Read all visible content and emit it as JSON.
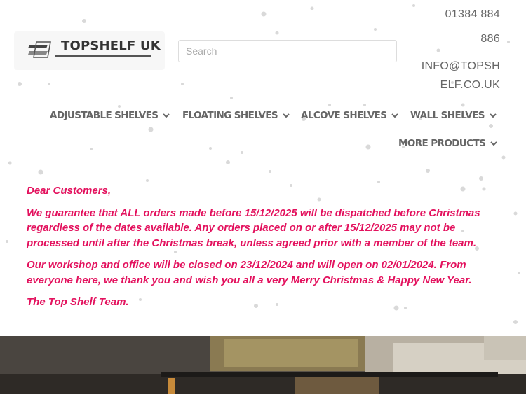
{
  "header": {
    "logo_text": "TOPSHELF UK",
    "search": {
      "placeholder": "Search"
    },
    "phone": {
      "line1": "01384 884",
      "line2": "886"
    },
    "email": {
      "line1": "INFO@TOPSH",
      "line2": "ELF.CO.UK"
    }
  },
  "nav": {
    "items": [
      {
        "label": "ADJUSTABLE SHELVES",
        "icon": "chevron-down-icon"
      },
      {
        "label": "FLOATING SHELVES",
        "icon": "chevron-down-icon"
      },
      {
        "label": "ALCOVE SHELVES",
        "icon": "chevron-down-icon"
      },
      {
        "label": "WALL SHELVES",
        "icon": "chevron-down-icon"
      },
      {
        "label": "MORE PRODUCTS",
        "icon": "chevron-down-icon"
      }
    ]
  },
  "notice": {
    "greeting": "Dear Customers,",
    "paragraph1": "We guarantee that ALL orders made before 15/12/2025 will be dispatched before Christmas regardless of the dates available. Any orders placed on or after 15/12/2025 may not be processed until after the Christmas break, unless agreed prior with a member of the team.",
    "paragraph2": "Our workshop and office will be closed on 23/12/2024 and will open on 02/01/2024. From everyone here, we thank you and wish you all a very Merry Christmas & Happy New Year.",
    "signoff": "The Top Shelf Team."
  },
  "colors": {
    "notice_text": "#e3125e",
    "nav_text": "#666666",
    "contact_text": "#666666",
    "snowflake": "#d8d8d8"
  }
}
